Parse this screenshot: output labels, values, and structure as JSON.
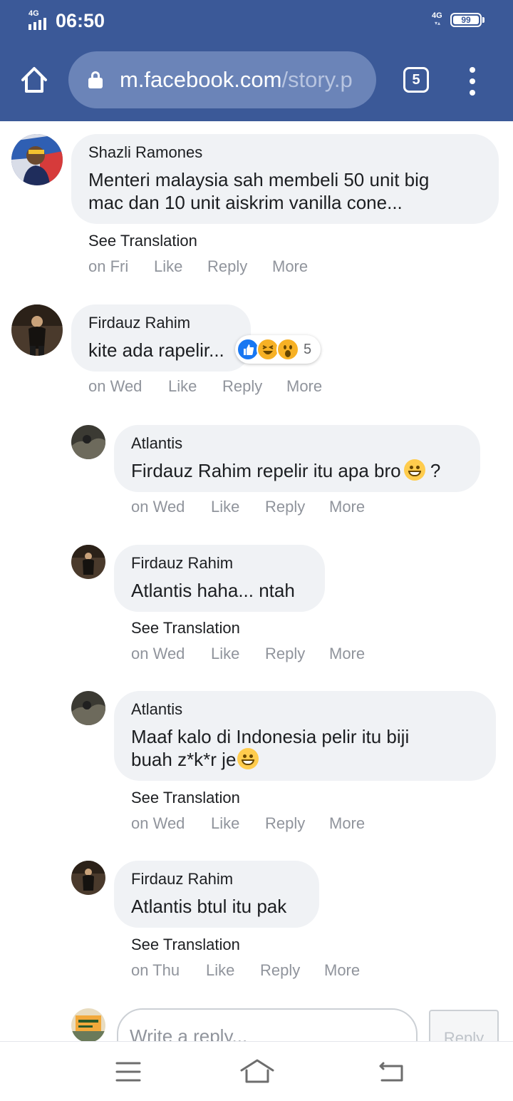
{
  "status_bar": {
    "network_left": "4G",
    "time": "06:50",
    "network_right": "4G",
    "battery": "99"
  },
  "browser": {
    "url_host": "m.facebook.com",
    "url_path": "/story.p",
    "tab_count": "5"
  },
  "comments": [
    {
      "author": "Shazli Ramones",
      "lines": [
        "Menteri malaysia sah membeli 50 unit big",
        "mac dan 10 unit aiskrim vanilla cone..."
      ],
      "see_translation": "See Translation",
      "time": "on Fri",
      "actions": [
        "Like",
        "Reply",
        "More"
      ]
    },
    {
      "author": "Firdauz Rahim",
      "lines": [
        "kite ada rapelir..."
      ],
      "reaction_count": "5",
      "reactions": [
        "like",
        "haha",
        "wow"
      ],
      "time": "on Wed",
      "actions": [
        "Like",
        "Reply",
        "More"
      ],
      "replies": [
        {
          "author": "Atlantis",
          "lines": [
            "Firdauz Rahim repelir itu apa bro",
            "?"
          ],
          "time": "on Wed",
          "actions": [
            "Like",
            "Reply",
            "More"
          ]
        },
        {
          "author": "Firdauz Rahim",
          "lines": [
            "Atlantis haha... ntah"
          ],
          "see_translation": "See Translation",
          "time": "on Wed",
          "actions": [
            "Like",
            "Reply",
            "More"
          ]
        },
        {
          "author": "Atlantis",
          "lines": [
            "Maaf kalo di Indonesia pelir itu biji",
            "buah z*k*r je"
          ],
          "see_translation": "See Translation",
          "time": "on Wed",
          "actions": [
            "Like",
            "Reply",
            "More"
          ]
        },
        {
          "author": "Firdauz Rahim",
          "lines": [
            "Atlantis btul itu pak"
          ],
          "see_translation": "See Translation",
          "time": "on Thu",
          "actions": [
            "Like",
            "Reply",
            "More"
          ]
        }
      ]
    }
  ],
  "composer": {
    "placeholder": "Write a reply...",
    "submit_label": "Reply"
  },
  "icons": [
    "home-icon",
    "lock-icon",
    "tabs-icon",
    "menu-icon",
    "hamburger-icon",
    "nav-home-icon",
    "back-icon",
    "grin-emoji",
    "smile-emoji",
    "like-reaction",
    "haha-reaction",
    "wow-reaction"
  ],
  "colors": {
    "brand": "#3b5998",
    "url_bar": "#6b84b8",
    "bubble": "#f0f2f5",
    "meta_text": "#90949c"
  }
}
